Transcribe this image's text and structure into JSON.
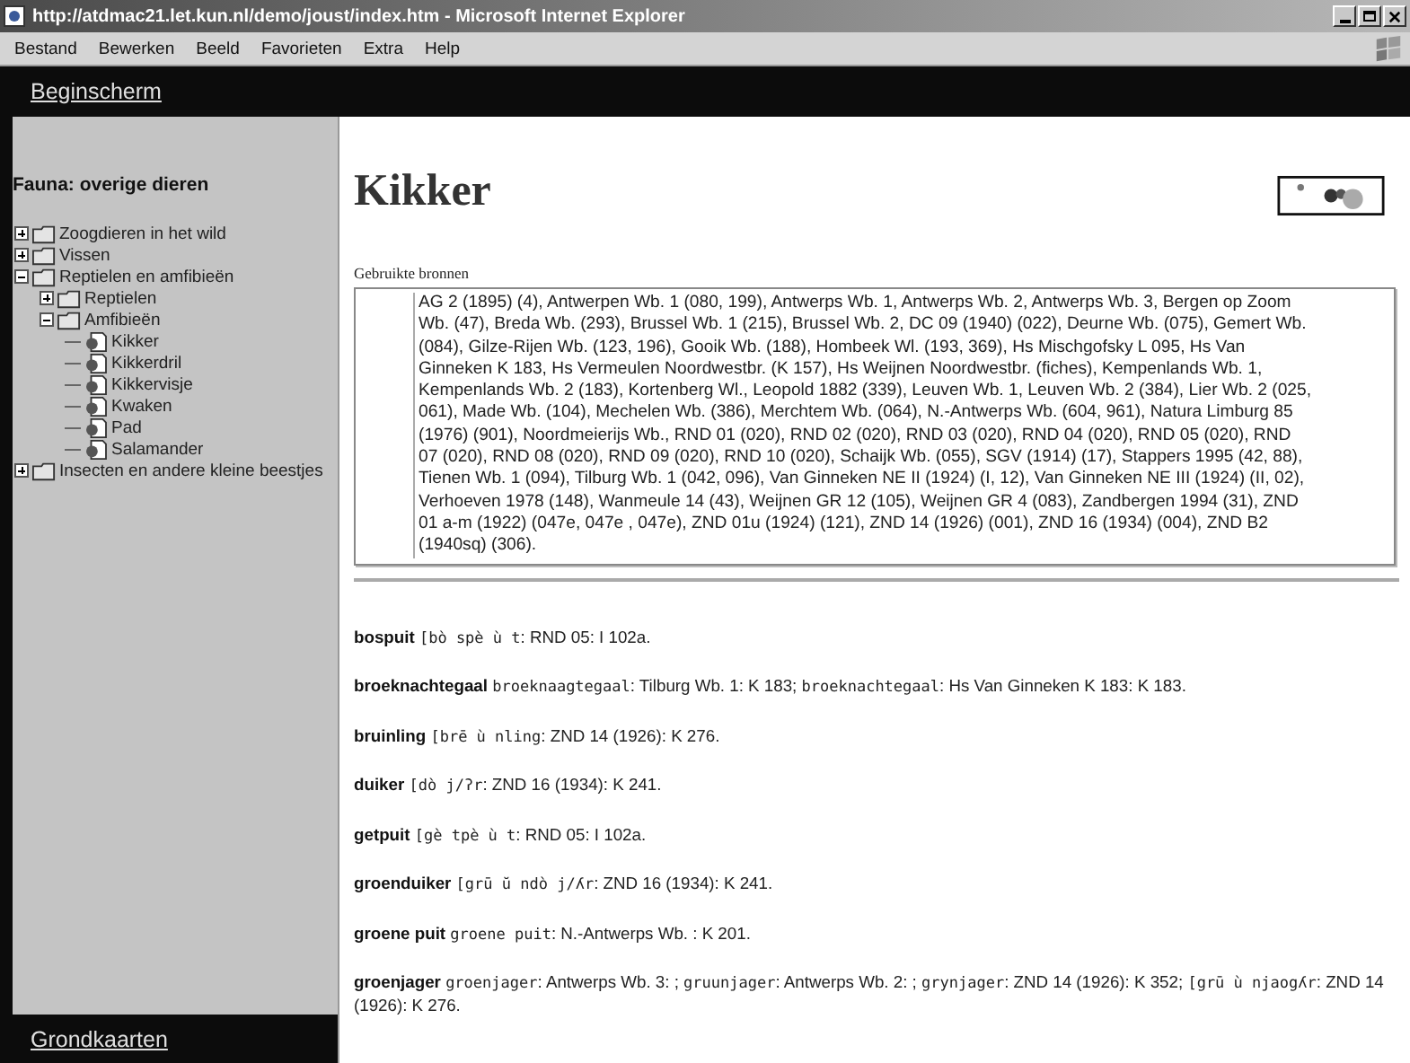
{
  "window": {
    "title": "http://atdmac21.let.kun.nl/demo/joust/index.htm - Microsoft Internet Explorer"
  },
  "menu": [
    "Bestand",
    "Bewerken",
    "Beeld",
    "Favorieten",
    "Extra",
    "Help"
  ],
  "top_link": "Beginscherm",
  "sidebar": {
    "heading": "Fauna: overige dieren",
    "tree": [
      {
        "label": "Zoogdieren in het wild",
        "kind": "folder",
        "expanded": false
      },
      {
        "label": "Vissen",
        "kind": "folder",
        "expanded": false
      },
      {
        "label": "Reptielen en amfibieën",
        "kind": "folder",
        "expanded": true,
        "children": [
          {
            "label": "Reptielen",
            "kind": "folder",
            "expanded": false
          },
          {
            "label": "Amfibieën",
            "kind": "folder",
            "expanded": true,
            "children": [
              {
                "label": "Kikker",
                "kind": "page"
              },
              {
                "label": "Kikkerdril",
                "kind": "page"
              },
              {
                "label": "Kikkervisje",
                "kind": "page"
              },
              {
                "label": "Kwaken",
                "kind": "page"
              },
              {
                "label": "Pad",
                "kind": "page"
              },
              {
                "label": "Salamander",
                "kind": "page"
              }
            ]
          }
        ]
      },
      {
        "label": "Insecten en andere kleine beestjes",
        "kind": "folder",
        "expanded": false
      }
    ],
    "bottom_link": "Grondkaarten"
  },
  "page": {
    "title": "Kikker",
    "sources_label": "Gebruikte bronnen",
    "sources": "AG 2 (1895) (4), Antwerpen Wb. 1 (080, 199), Antwerps Wb. 1, Antwerps Wb. 2, Antwerps Wb. 3, Bergen op Zoom Wb. (47), Breda Wb. (293), Brussel Wb. 1 (215), Brussel Wb. 2, DC 09 (1940) (022), Deurne Wb. (075), Gemert Wb. (084), Gilze-Rijen Wb. (123, 196), Gooik Wb. (188), Hombeek Wl. (193, 369), Hs Mischgofsky L 095, Hs Van Ginneken K 183, Hs Vermeulen Noordwestbr. (K 157), Hs Weijnen Noordwestbr. (fiches), Kempenlands Wb. 1, Kempenlands Wb. 2 (183), Kortenberg Wl., Leopold 1882 (339), Leuven Wb. 1, Leuven Wb. 2 (384), Lier Wb. 2 (025, 061), Made Wb. (104), Mechelen Wb. (386), Merchtem Wb. (064), N.-Antwerps Wb. (604, 961), Natura Limburg 85 (1976) (901), Noordmeierijs Wb., RND 01 (020), RND 02 (020), RND 03 (020), RND 04 (020), RND 05 (020), RND 07 (020), RND 08 (020), RND 09 (020), RND 10 (020), Schaijk Wb. (055), SGV (1914) (17), Stappers 1995 (42, 88), Tienen Wb. 1 (094), Tilburg Wb. 1 (042, 096), Van Ginneken NE II (1924) (I, 12), Van Ginneken NE III (1924) (II, 02), Verhoeven 1978 (148), Wanmeule 14 (43), Weijnen GR 12 (105), Weijnen GR 4 (083), Zandbergen 1994 (31), ZND 01 a-m (1922) (047e, 047e , 047e), ZND 01u (1924) (121), ZND 14 (1926) (001), ZND 16 (1934) (004), ZND B2 (1940sq) (306).",
    "entries": [
      {
        "headword": "bospuit",
        "parts": [
          {
            "kind": "phonetic",
            "text": "[bò spè ù t"
          },
          {
            "kind": "text",
            "text": ": RND 05: I 102a."
          }
        ]
      },
      {
        "headword": "broeknachtegaal",
        "parts": [
          {
            "kind": "phonetic",
            "text": "broeknaagtegaal"
          },
          {
            "kind": "text",
            "text": ": Tilburg Wb. 1: K 183;"
          },
          {
            "kind": "phonetic",
            "text": "broeknachtegaal"
          },
          {
            "kind": "text",
            "text": ": Hs Van Ginneken K 183: K 183."
          }
        ]
      },
      {
        "headword": "bruinling",
        "parts": [
          {
            "kind": "phonetic",
            "text": "[brē ù nling"
          },
          {
            "kind": "text",
            "text": ": ZND 14 (1926): K 276."
          }
        ]
      },
      {
        "headword": "duiker",
        "parts": [
          {
            "kind": "phonetic",
            "text": "[dò j/ʔr"
          },
          {
            "kind": "text",
            "text": ": ZND 16 (1934): K 241."
          }
        ]
      },
      {
        "headword": "getpuit",
        "parts": [
          {
            "kind": "phonetic",
            "text": "[gè tpè ù t"
          },
          {
            "kind": "text",
            "text": ": RND 05: I 102a."
          }
        ]
      },
      {
        "headword": "groenduiker",
        "parts": [
          {
            "kind": "phonetic",
            "text": "[grū ŭ ndò j/ʎr"
          },
          {
            "kind": "text",
            "text": ": ZND 16 (1934): K 241."
          }
        ]
      },
      {
        "headword": "groene puit",
        "parts": [
          {
            "kind": "phonetic",
            "text": "groene puit"
          },
          {
            "kind": "text",
            "text": ": N.-Antwerps Wb. : K 201."
          }
        ]
      },
      {
        "headword": "groenjager",
        "parts": [
          {
            "kind": "phonetic",
            "text": "groenjager"
          },
          {
            "kind": "text",
            "text": ": Antwerps Wb. 3: ;"
          },
          {
            "kind": "phonetic",
            "text": "gruunjager"
          },
          {
            "kind": "text",
            "text": ": Antwerps Wb. 2: ;"
          },
          {
            "kind": "phonetic",
            "text": "grynjager"
          },
          {
            "kind": "text",
            "text": ": ZND 14 (1926): K 352;"
          },
          {
            "kind": "phonetic",
            "text": "[grū ù njaogʎr"
          },
          {
            "kind": "text",
            "text": ": ZND 14 (1926): K 276."
          }
        ]
      }
    ]
  }
}
